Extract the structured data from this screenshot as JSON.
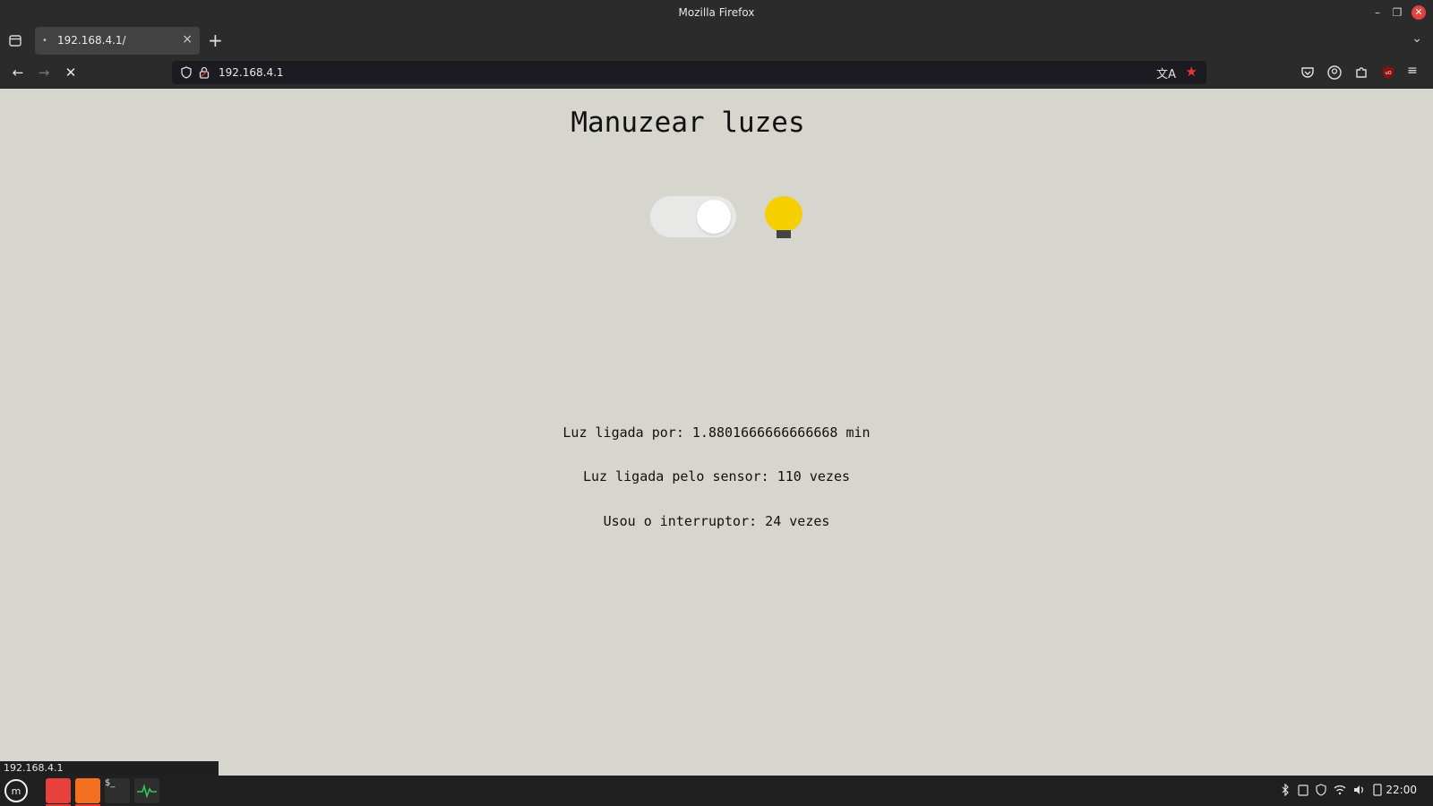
{
  "window": {
    "title": "Mozilla Firefox"
  },
  "tabs": [
    {
      "label": "192.168.4.1/"
    }
  ],
  "toolbar": {
    "url": "192.168.4.1"
  },
  "page": {
    "heading": "Manuzear luzes",
    "toggle_on": true,
    "bulb_color": "#f6cf00",
    "stats": [
      "Luz ligada por: 1.8801666666666668 min",
      "Luz ligada pelo sensor: 110 vezes",
      "Usou o interruptor: 24 vezes"
    ]
  },
  "statusbar": {
    "text": "192.168.4.1"
  },
  "taskbar": {
    "clock": "22:00"
  },
  "colors": {
    "accent": "#e8372f",
    "background": "#d6d5ce",
    "chrome": "#2b2b2b"
  }
}
